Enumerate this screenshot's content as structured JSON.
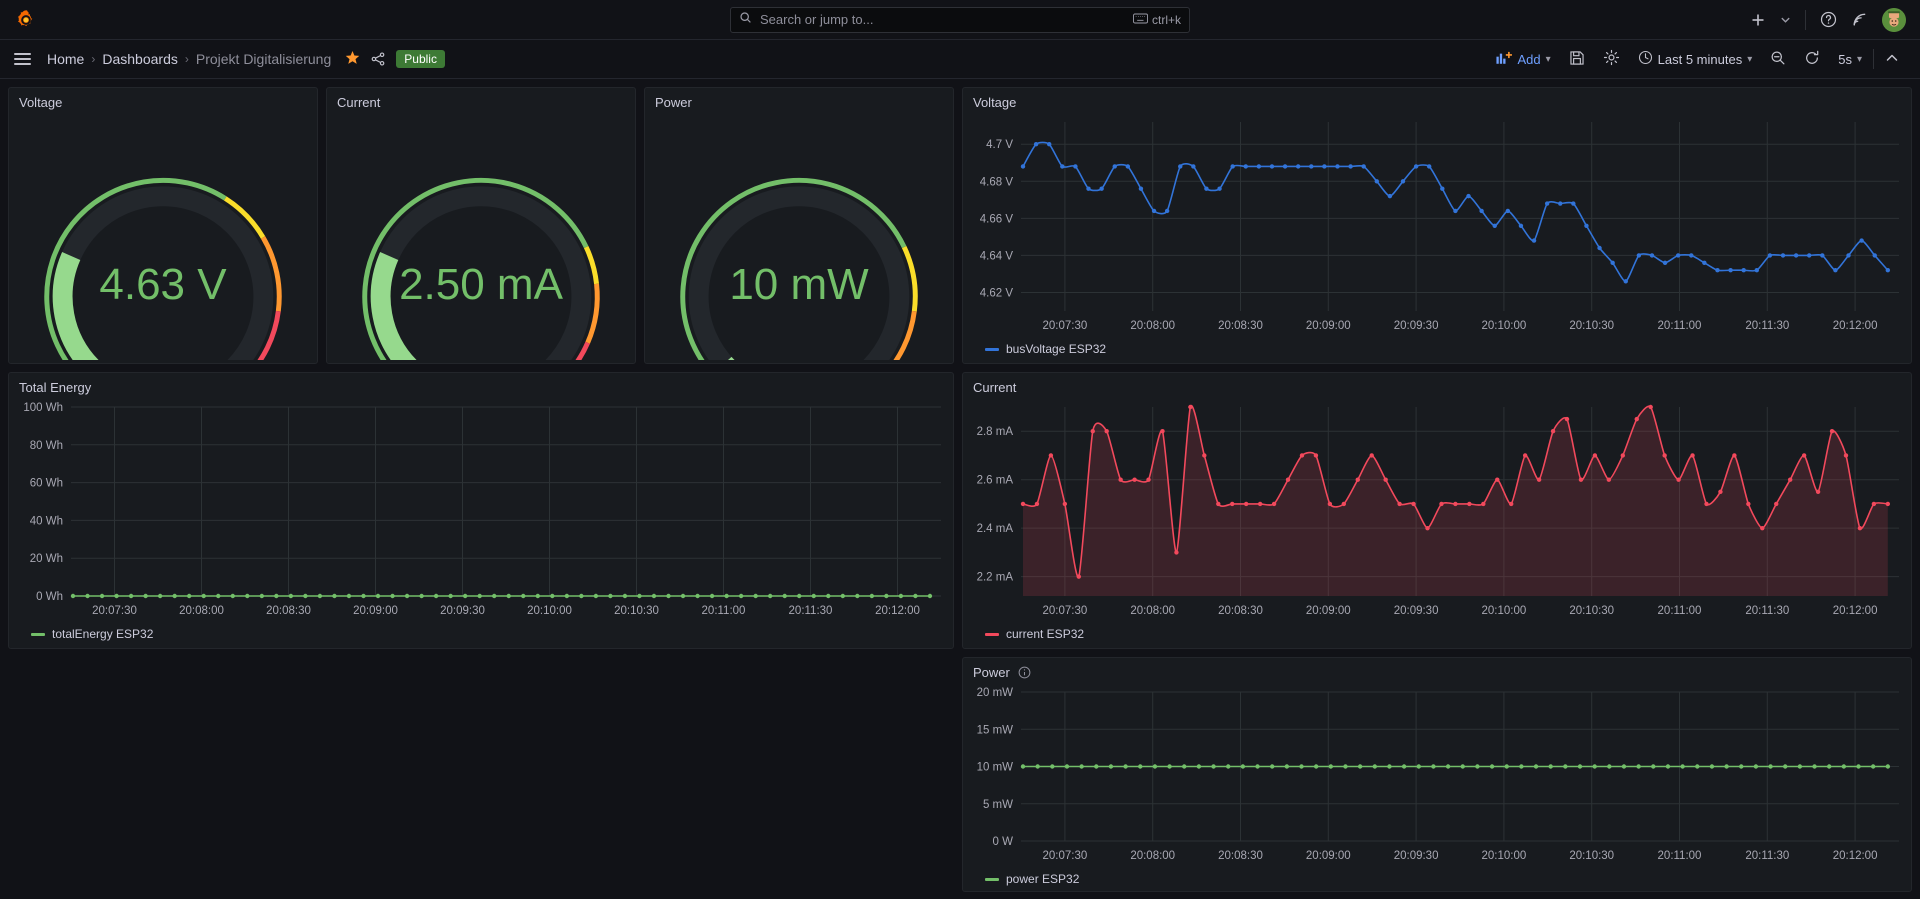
{
  "app": {
    "logo_icon": "grafana-logo-icon",
    "search": {
      "placeholder": "Search or jump to...",
      "shortcut": "ctrl+k",
      "icon": "search-icon",
      "kbd_icon": "keyboard-icon"
    },
    "right_icons": [
      {
        "name": "plus-icon",
        "label": "+"
      },
      {
        "name": "chevron-down-icon",
        "label": "⌄"
      },
      {
        "name": "help-circle-icon",
        "label": "?"
      },
      {
        "name": "news-rss-icon",
        "label": "rss"
      }
    ],
    "avatar": {
      "name": "user-avatar",
      "alt": "User profile"
    }
  },
  "toolbar": {
    "menu_icon": "hamburger-menu-icon",
    "breadcrumbs": [
      {
        "label": "Home",
        "current": false
      },
      {
        "label": "Dashboards",
        "current": false
      },
      {
        "label": "Projekt Digitalisierung",
        "current": true
      }
    ],
    "separator": "›",
    "star_icon": "star-filled-icon",
    "share_icon": "share-nodes-icon",
    "public_badge": "Public",
    "add_label": "Add",
    "add_icon": "add-panel-icon",
    "save_icon": "save-disk-icon",
    "settings_icon": "gear-icon",
    "time_range": "Last 5 minutes",
    "time_icon": "clock-icon",
    "zoom_out_icon": "zoom-out-icon",
    "refresh_icon": "refresh-icon",
    "refresh_interval": "5s",
    "collapse_icon": "chevron-up-icon"
  },
  "panels": {
    "gauge_voltage": {
      "title": "Voltage",
      "value": "4.63 V",
      "fill_fraction": 0.255,
      "threshold_stops": [
        0.62,
        0.72,
        0.86
      ]
    },
    "gauge_current": {
      "title": "Current",
      "value": "2.50 mA",
      "fill_fraction": 0.255,
      "threshold_stops": [
        0.74,
        0.81,
        0.92
      ]
    },
    "gauge_power": {
      "title": "Power",
      "value": "10 mW",
      "fill_fraction": 0.012,
      "threshold_stops": [
        0.74,
        0.86,
        1.0
      ]
    },
    "ts_voltage": {
      "title": "Voltage",
      "legend": "busVoltage ESP32"
    },
    "ts_energy": {
      "title": "Total Energy",
      "legend": "totalEnergy ESP32"
    },
    "ts_current": {
      "title": "Current",
      "legend": "current ESP32"
    },
    "ts_power": {
      "title": "Power",
      "legend": "power ESP32",
      "info_icon": "info-circle-icon"
    }
  },
  "colors": {
    "green": "#73bf69",
    "yellow": "#fade2a",
    "orange": "#ff9830",
    "red": "#f2495c",
    "blue": "#3274d9",
    "grid": "#2c3235",
    "panel_bg": "#181b1f",
    "accent": "#6e9fff",
    "public_badge_bg": "#3d7a35"
  },
  "chart_data": [
    {
      "id": "ts_voltage",
      "type": "line",
      "title": "Voltage",
      "xlabel": "",
      "ylabel": "",
      "unit": "V",
      "ylim": [
        4.61,
        4.712
      ],
      "yticks": [
        4.62,
        4.64,
        4.66,
        4.68,
        4.7
      ],
      "ytick_labels": [
        "4.62 V",
        "4.64 V",
        "4.66 V",
        "4.68 V",
        "4.7 V"
      ],
      "xtick_labels": [
        "20:07:30",
        "20:08:00",
        "20:08:30",
        "20:09:00",
        "20:09:30",
        "20:10:00",
        "20:10:30",
        "20:11:00",
        "20:11:30",
        "20:12:00"
      ],
      "grid": true,
      "legend": [
        {
          "name": "busVoltage ESP32",
          "color": "#3274d9"
        }
      ],
      "legend_position": "bottom-left",
      "series": [
        {
          "name": "busVoltage ESP32",
          "color": "#3274d9",
          "show_points": true,
          "values": [
            4.688,
            4.7,
            4.7,
            4.688,
            4.688,
            4.676,
            4.676,
            4.688,
            4.688,
            4.676,
            4.664,
            4.664,
            4.688,
            4.688,
            4.676,
            4.676,
            4.688,
            4.688,
            4.688,
            4.688,
            4.688,
            4.688,
            4.688,
            4.688,
            4.688,
            4.688,
            4.688,
            4.68,
            4.672,
            4.68,
            4.688,
            4.688,
            4.676,
            4.664,
            4.672,
            4.664,
            4.656,
            4.664,
            4.656,
            4.648,
            4.668,
            4.668,
            4.668,
            4.656,
            4.644,
            4.636,
            4.626,
            4.64,
            4.64,
            4.636,
            4.64,
            4.64,
            4.636,
            4.632,
            4.632,
            4.632,
            4.632,
            4.64,
            4.64,
            4.64,
            4.64,
            4.64,
            4.632,
            4.64,
            4.648,
            4.64,
            4.632
          ]
        }
      ]
    },
    {
      "id": "ts_energy",
      "type": "line",
      "title": "Total Energy",
      "unit": "Wh",
      "ylim": [
        0,
        100
      ],
      "yticks": [
        0,
        20,
        40,
        60,
        80,
        100
      ],
      "ytick_labels": [
        "0 Wh",
        "20 Wh",
        "40 Wh",
        "60 Wh",
        "80 Wh",
        "100 Wh"
      ],
      "xtick_labels": [
        "20:07:30",
        "20:08:00",
        "20:08:30",
        "20:09:00",
        "20:09:30",
        "20:10:00",
        "20:10:30",
        "20:11:00",
        "20:11:30",
        "20:12:00"
      ],
      "grid": true,
      "legend": [
        {
          "name": "totalEnergy ESP32",
          "color": "#73bf69"
        }
      ],
      "legend_position": "bottom-left",
      "series": [
        {
          "name": "totalEnergy ESP32",
          "color": "#73bf69",
          "show_points": true,
          "constant": 0,
          "n_points": 60
        }
      ]
    },
    {
      "id": "ts_current",
      "type": "area",
      "title": "Current",
      "unit": "mA",
      "ylim": [
        2.12,
        2.9
      ],
      "yticks": [
        2.2,
        2.4,
        2.6,
        2.8
      ],
      "ytick_labels": [
        "2.2 mA",
        "2.4 mA",
        "2.6 mA",
        "2.8 mA"
      ],
      "xtick_labels": [
        "20:07:30",
        "20:08:00",
        "20:08:30",
        "20:09:00",
        "20:09:30",
        "20:10:00",
        "20:10:30",
        "20:11:00",
        "20:11:30",
        "20:12:00"
      ],
      "grid": true,
      "legend": [
        {
          "name": "current ESP32",
          "color": "#f2495c"
        }
      ],
      "legend_position": "bottom-left",
      "series": [
        {
          "name": "current ESP32",
          "color": "#f2495c",
          "show_points": true,
          "fill": true,
          "values": [
            2.5,
            2.5,
            2.7,
            2.5,
            2.2,
            2.8,
            2.8,
            2.6,
            2.6,
            2.6,
            2.8,
            2.3,
            2.9,
            2.7,
            2.5,
            2.5,
            2.5,
            2.5,
            2.5,
            2.6,
            2.7,
            2.7,
            2.5,
            2.5,
            2.6,
            2.7,
            2.6,
            2.5,
            2.5,
            2.4,
            2.5,
            2.5,
            2.5,
            2.5,
            2.6,
            2.5,
            2.7,
            2.6,
            2.8,
            2.85,
            2.6,
            2.7,
            2.6,
            2.7,
            2.85,
            2.9,
            2.7,
            2.6,
            2.7,
            2.5,
            2.55,
            2.7,
            2.5,
            2.4,
            2.5,
            2.6,
            2.7,
            2.55,
            2.8,
            2.7,
            2.4,
            2.5,
            2.5
          ]
        }
      ]
    },
    {
      "id": "ts_power",
      "type": "line",
      "title": "Power",
      "unit": "mW",
      "ylim": [
        0,
        20
      ],
      "yticks": [
        0,
        5,
        10,
        15,
        20
      ],
      "ytick_labels": [
        "0 W",
        "5 mW",
        "10 mW",
        "15 mW",
        "20 mW"
      ],
      "xtick_labels": [
        "20:07:30",
        "20:08:00",
        "20:08:30",
        "20:09:00",
        "20:09:30",
        "20:10:00",
        "20:10:30",
        "20:11:00",
        "20:11:30",
        "20:12:00"
      ],
      "grid": true,
      "legend": [
        {
          "name": "power ESP32",
          "color": "#73bf69"
        }
      ],
      "legend_position": "bottom-left",
      "series": [
        {
          "name": "power ESP32",
          "color": "#73bf69",
          "show_points": true,
          "constant": 10,
          "n_points": 60
        }
      ]
    }
  ]
}
